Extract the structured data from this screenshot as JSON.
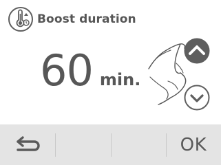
{
  "header": {
    "title": "Boost duration",
    "icon": "thermometer-boost-icon"
  },
  "duration": {
    "value": "60",
    "unit": "min."
  },
  "controls": {
    "increase_icon": "chevron-up-icon",
    "decrease_icon": "chevron-down-icon",
    "hint_icon": "hand-swipe-icon"
  },
  "footer": {
    "back_icon": "back-arrow-icon",
    "ok_label": "OK"
  },
  "colors": {
    "text": "#575757",
    "footer_bg": "#e4e4e4",
    "active_button": "#5e5e5e"
  }
}
